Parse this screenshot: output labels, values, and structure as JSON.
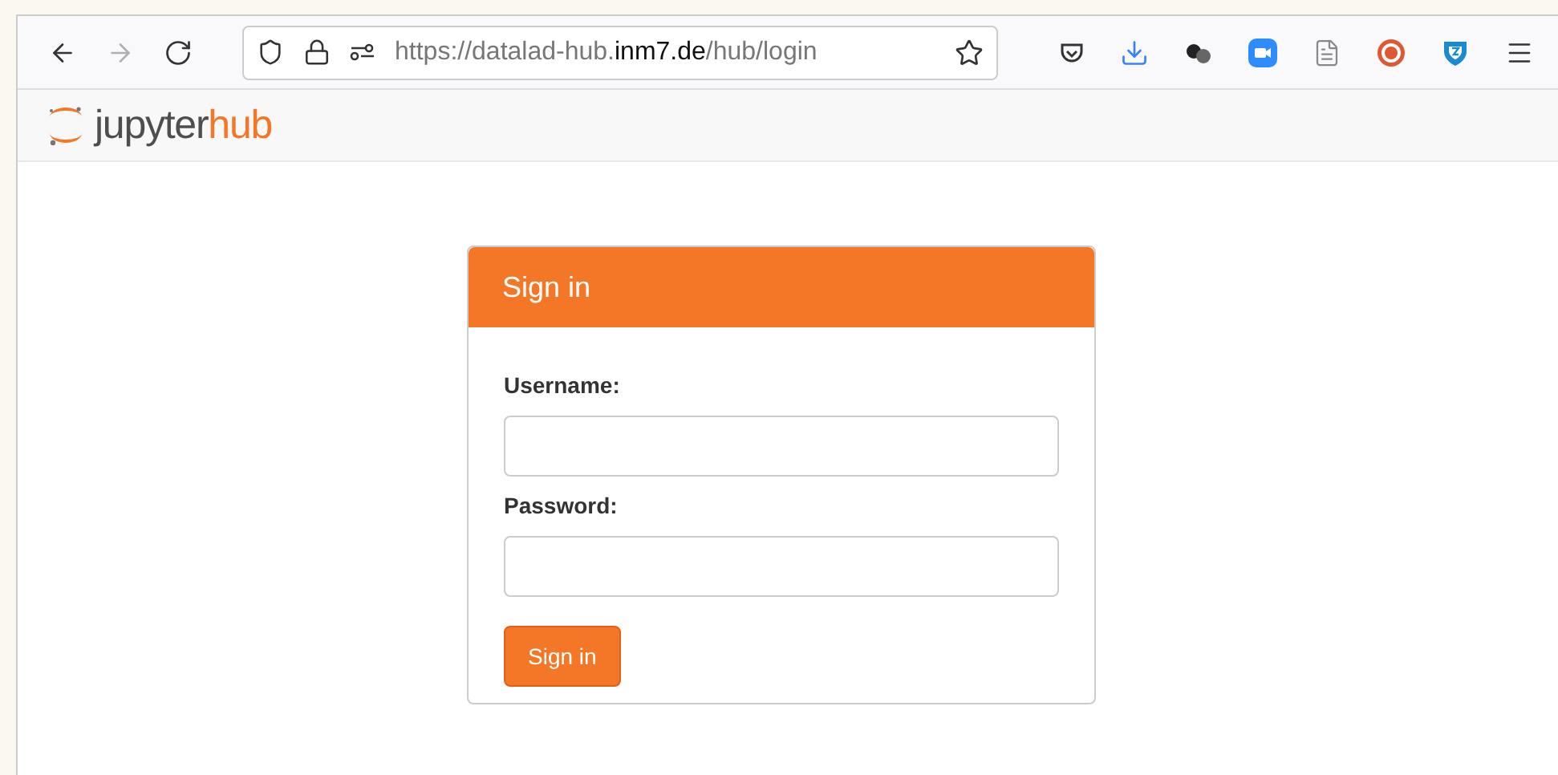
{
  "browser": {
    "nav_buttons": [
      {
        "kind": "back",
        "disabled": false
      },
      {
        "kind": "forward",
        "disabled": true
      },
      {
        "kind": "reload",
        "disabled": false
      }
    ],
    "url": [
      {
        "text": "https://datalad-hub.",
        "emphasized": false
      },
      {
        "text": "inm7.de",
        "emphasized": true
      },
      {
        "text": "/hub/login",
        "emphasized": false
      }
    ],
    "toolbar_icons": [
      {
        "kind": "pocket"
      },
      {
        "kind": "download"
      },
      {
        "kind": "extension"
      },
      {
        "kind": "video"
      },
      {
        "kind": "reader"
      },
      {
        "kind": "duck"
      },
      {
        "kind": "shield"
      },
      {
        "kind": "menu"
      }
    ]
  },
  "header": {
    "logo": {
      "word": "jupyter",
      "accent": "hub"
    }
  },
  "login": {
    "title": "Sign in",
    "fields": [
      {
        "label": "Username:"
      },
      {
        "label": "Password:"
      }
    ],
    "button": "Sign in"
  }
}
